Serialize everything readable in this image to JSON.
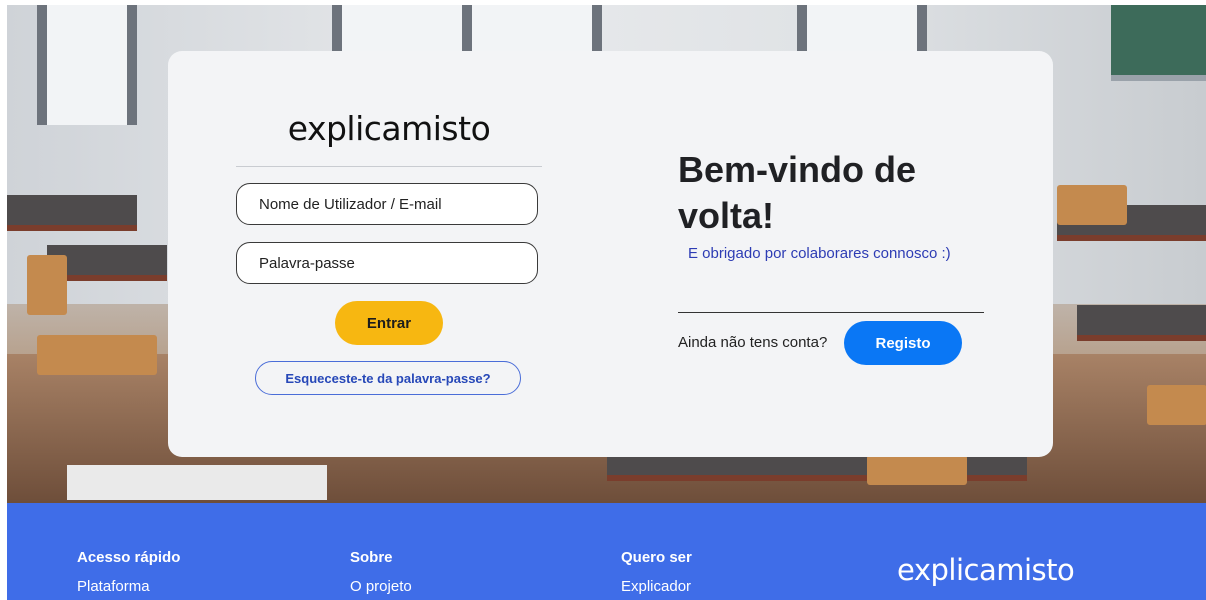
{
  "brand": {
    "logo_text": "explicamisto",
    "accent_color": "#2b63f0"
  },
  "login": {
    "username_placeholder": "Nome de Utilizador / E-mail",
    "password_placeholder": "Palavra-passe",
    "submit_label": "Entrar",
    "forgot_label": "Esqueceste-te da palavra-passe?"
  },
  "welcome": {
    "title": "Bem-vindo de volta!",
    "subtitle": "E obrigado por colaborares connosco :)",
    "no_account_text": "Ainda não tens conta?",
    "register_label": "Registo"
  },
  "footer": {
    "columns": [
      {
        "heading": "Acesso rápido",
        "link": "Plataforma"
      },
      {
        "heading": "Sobre",
        "link": "O projeto"
      },
      {
        "heading": "Quero ser",
        "link": "Explicador"
      }
    ],
    "logo_text": "explicamisto"
  },
  "colors": {
    "primary_button": "#f7b711",
    "register_button": "#0a77f5",
    "footer_bg": "#3f6de8"
  }
}
